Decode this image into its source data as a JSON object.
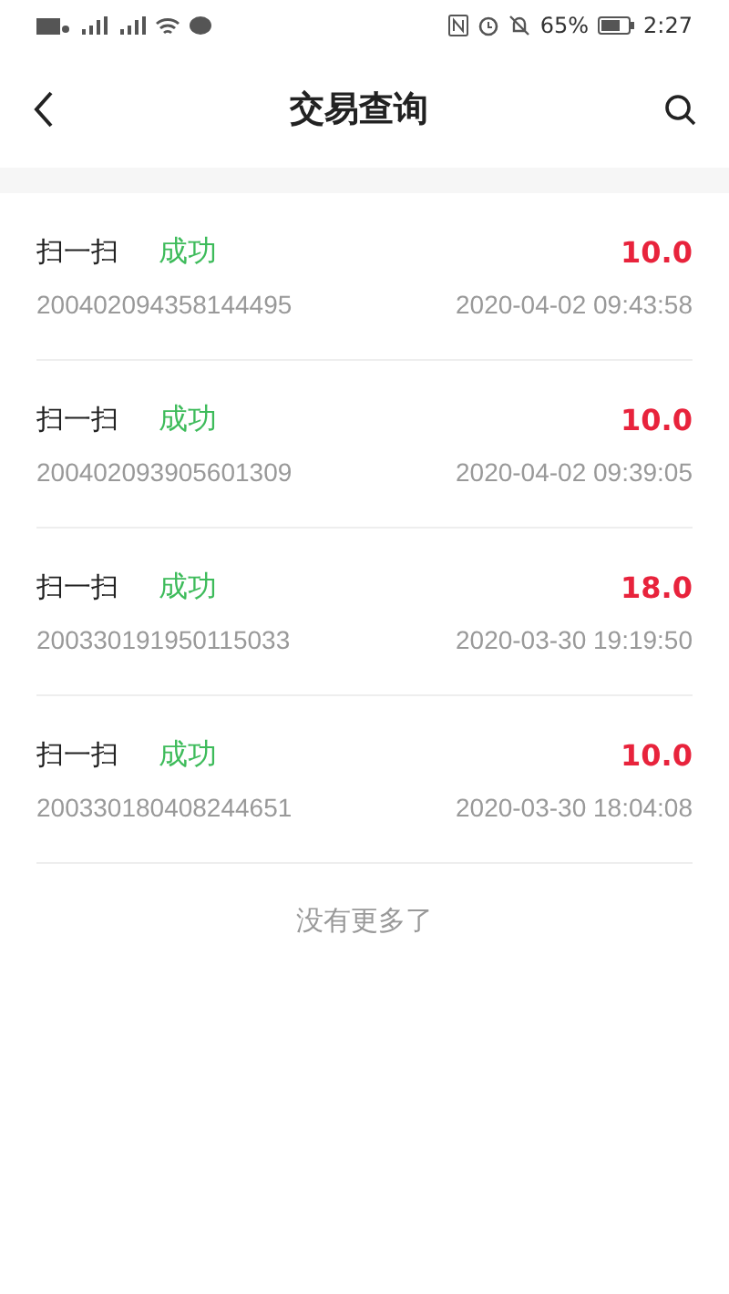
{
  "status_bar": {
    "battery": "65%",
    "time": "2:27"
  },
  "nav": {
    "title": "交易查询"
  },
  "transactions": [
    {
      "type": "扫一扫",
      "status": "成功",
      "color": "#3dbb5a",
      "amount": "10.0",
      "order_no": "200402094358144495",
      "time": "2020-04-02 09:43:58"
    },
    {
      "type": "扫一扫",
      "status": "成功",
      "color": "#3dbb5a",
      "amount": "10.0",
      "order_no": "200402093905601309",
      "time": "2020-04-02 09:39:05"
    },
    {
      "type": "扫一扫",
      "status": "成功",
      "color": "#3dbb5a",
      "amount": "18.0",
      "order_no": "200330191950115033",
      "time": "2020-03-30 19:19:50"
    },
    {
      "type": "扫一扫",
      "status": "成功",
      "color": "#3dbb5a",
      "amount": "10.0",
      "order_no": "200330180408244651",
      "time": "2020-03-30 18:04:08"
    }
  ],
  "footer": "没有更多了"
}
